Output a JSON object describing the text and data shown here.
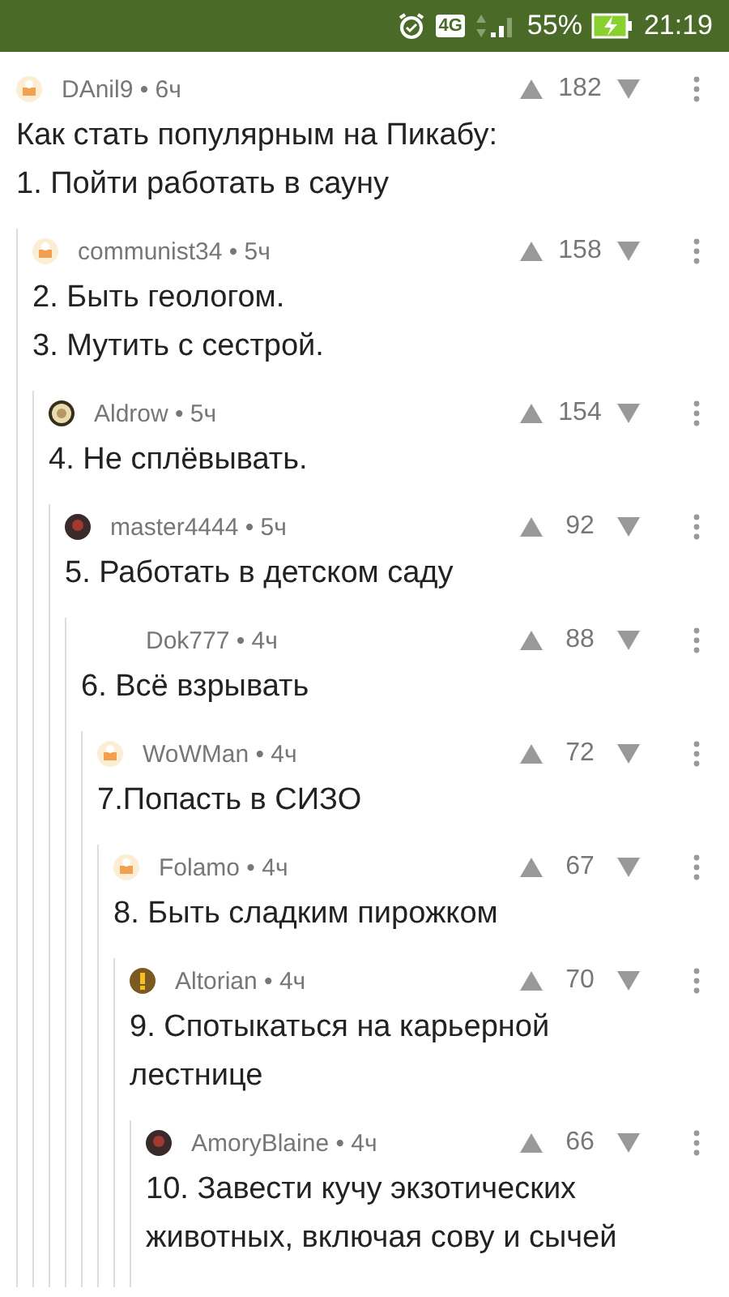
{
  "status_bar": {
    "network": "4G",
    "battery": "55%",
    "time": "21:19"
  },
  "comments": [
    {
      "byline": "DAnil9 • 6ч",
      "score": "182",
      "avatar": {
        "kind": "default"
      },
      "paragraphs": [
        "Как стать популярным на Пикабу:",
        "1. Пойти работать в сауну"
      ],
      "children": [
        {
          "byline": "communist34 • 5ч",
          "score": "158",
          "avatar": {
            "kind": "default"
          },
          "paragraphs": [
            "2. Быть геологом.",
            "3. Мутить с сестрой."
          ],
          "children": [
            {
              "byline": "Aldrow • 5ч",
              "score": "154",
              "avatar": {
                "kind": "round"
              },
              "paragraphs": [
                "4. Не сплёвывать."
              ],
              "children": [
                {
                  "byline": "master4444 • 5ч",
                  "score": "92",
                  "avatar": {
                    "kind": "photo"
                  },
                  "paragraphs": [
                    "5. Работать в детском саду"
                  ],
                  "children": [
                    {
                      "byline": "Dok777 • 4ч",
                      "score": "88",
                      "paragraphs": [
                        "6. Всё взрывать"
                      ],
                      "children": [
                        {
                          "byline": "WoWMan • 4ч",
                          "score": "72",
                          "avatar": {
                            "kind": "default"
                          },
                          "paragraphs": [
                            "7.Попасть в СИЗО"
                          ],
                          "children": [
                            {
                              "byline": "Folamo • 4ч",
                              "score": "67",
                              "avatar": {
                                "kind": "default"
                              },
                              "paragraphs": [
                                "8. Быть сладким пирожком"
                              ],
                              "children": [
                                {
                                  "byline": "Altorian • 4ч",
                                  "score": "70",
                                  "avatar": {
                                    "kind": "exclaim"
                                  },
                                  "paragraphs": [
                                    "9. Спотыкаться на карьерной лестнице"
                                  ],
                                  "children": [
                                    {
                                      "byline": "AmoryBlaine • 4ч",
                                      "score": "66",
                                      "avatar": {
                                        "kind": "photo"
                                      },
                                      "paragraphs": [
                                        "10. Завести кучу экзотических животных, включая сову и сычей"
                                      ]
                                    }
                                  ]
                                }
                              ]
                            }
                          ]
                        }
                      ]
                    }
                  ]
                }
              ]
            }
          ]
        }
      ]
    }
  ]
}
